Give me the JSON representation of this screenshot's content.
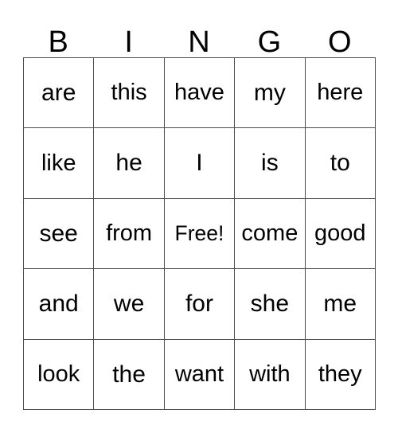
{
  "card": {
    "header_letters": [
      "B",
      "I",
      "N",
      "G",
      "O"
    ],
    "free_space_label": "Free!",
    "rows": [
      {
        "cells": [
          "are",
          "this",
          "have",
          "my",
          "here"
        ]
      },
      {
        "cells": [
          "like",
          "he",
          "I",
          "is",
          "to"
        ]
      },
      {
        "cells": [
          "see",
          "from",
          "Free!",
          "come",
          "good"
        ]
      },
      {
        "cells": [
          "and",
          "we",
          "for",
          "she",
          "me"
        ]
      },
      {
        "cells": [
          "look",
          "the",
          "want",
          "with",
          "they"
        ]
      }
    ],
    "colors": {
      "background": "#ffffff",
      "grid_line": "#4d4d4d",
      "text": "#000000"
    }
  }
}
